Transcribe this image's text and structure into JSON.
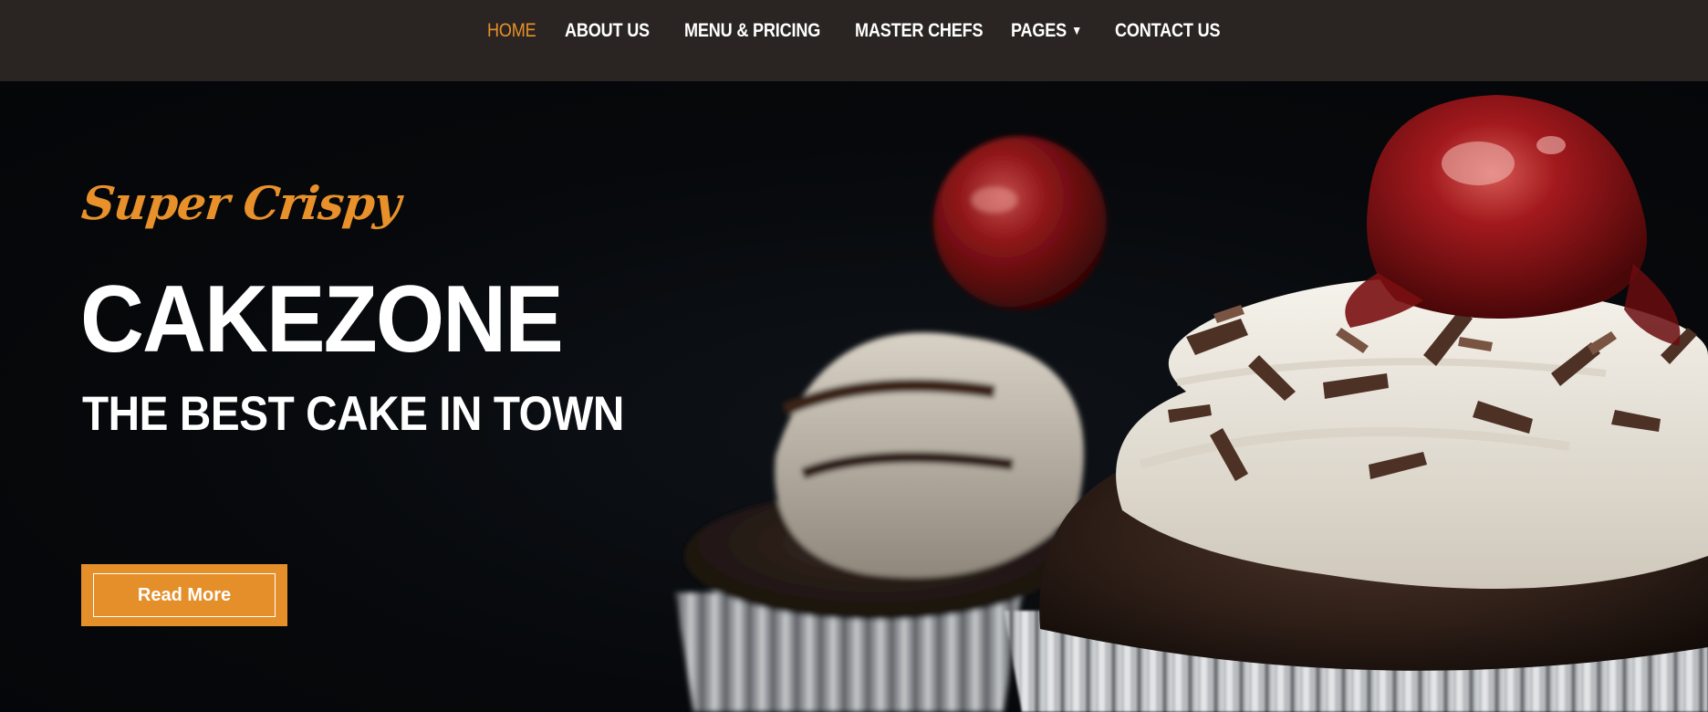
{
  "nav": {
    "items": [
      {
        "label": "HOME",
        "active": true
      },
      {
        "label": "ABOUT US"
      },
      {
        "label": "MENU & PRICING"
      },
      {
        "label": "MASTER CHEFS"
      },
      {
        "label": "PAGES",
        "has_dropdown": true,
        "dropdown_icon": "caret-down-icon"
      },
      {
        "label": "CONTACT US"
      }
    ]
  },
  "hero": {
    "tagline": "Super Crispy",
    "brand": "CAKEZONE",
    "subtitle": "THE BEST CAKE IN TOWN",
    "cta_label": "Read More",
    "image": "chocolate-cupcakes-with-cherries-photo"
  },
  "colors": {
    "accent": "#e8902a",
    "navbar_bg": "#2a2522",
    "hero_bg": "#070a0e",
    "text": "#ffffff"
  }
}
